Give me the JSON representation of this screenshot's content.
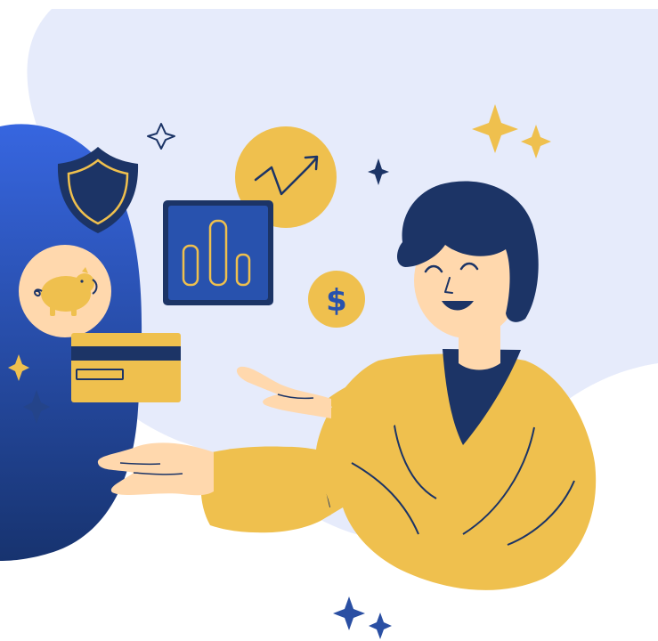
{
  "illustration": {
    "coin_symbol": "$",
    "icons": [
      "shield-icon",
      "trend-chart-icon",
      "bar-chart-icon",
      "piggy-bank-icon",
      "credit-card-icon",
      "dollar-coin-icon",
      "sparkle-icon"
    ],
    "colors": {
      "background_blob": "#e6ebfb",
      "navy": "#1c3466",
      "blue_gradient_top": "#3a66dd",
      "blue_gradient_bottom": "#183572",
      "mustard": "#efc04e",
      "skin": "#ffd8ad",
      "dark_hair": "#1c3466"
    }
  }
}
